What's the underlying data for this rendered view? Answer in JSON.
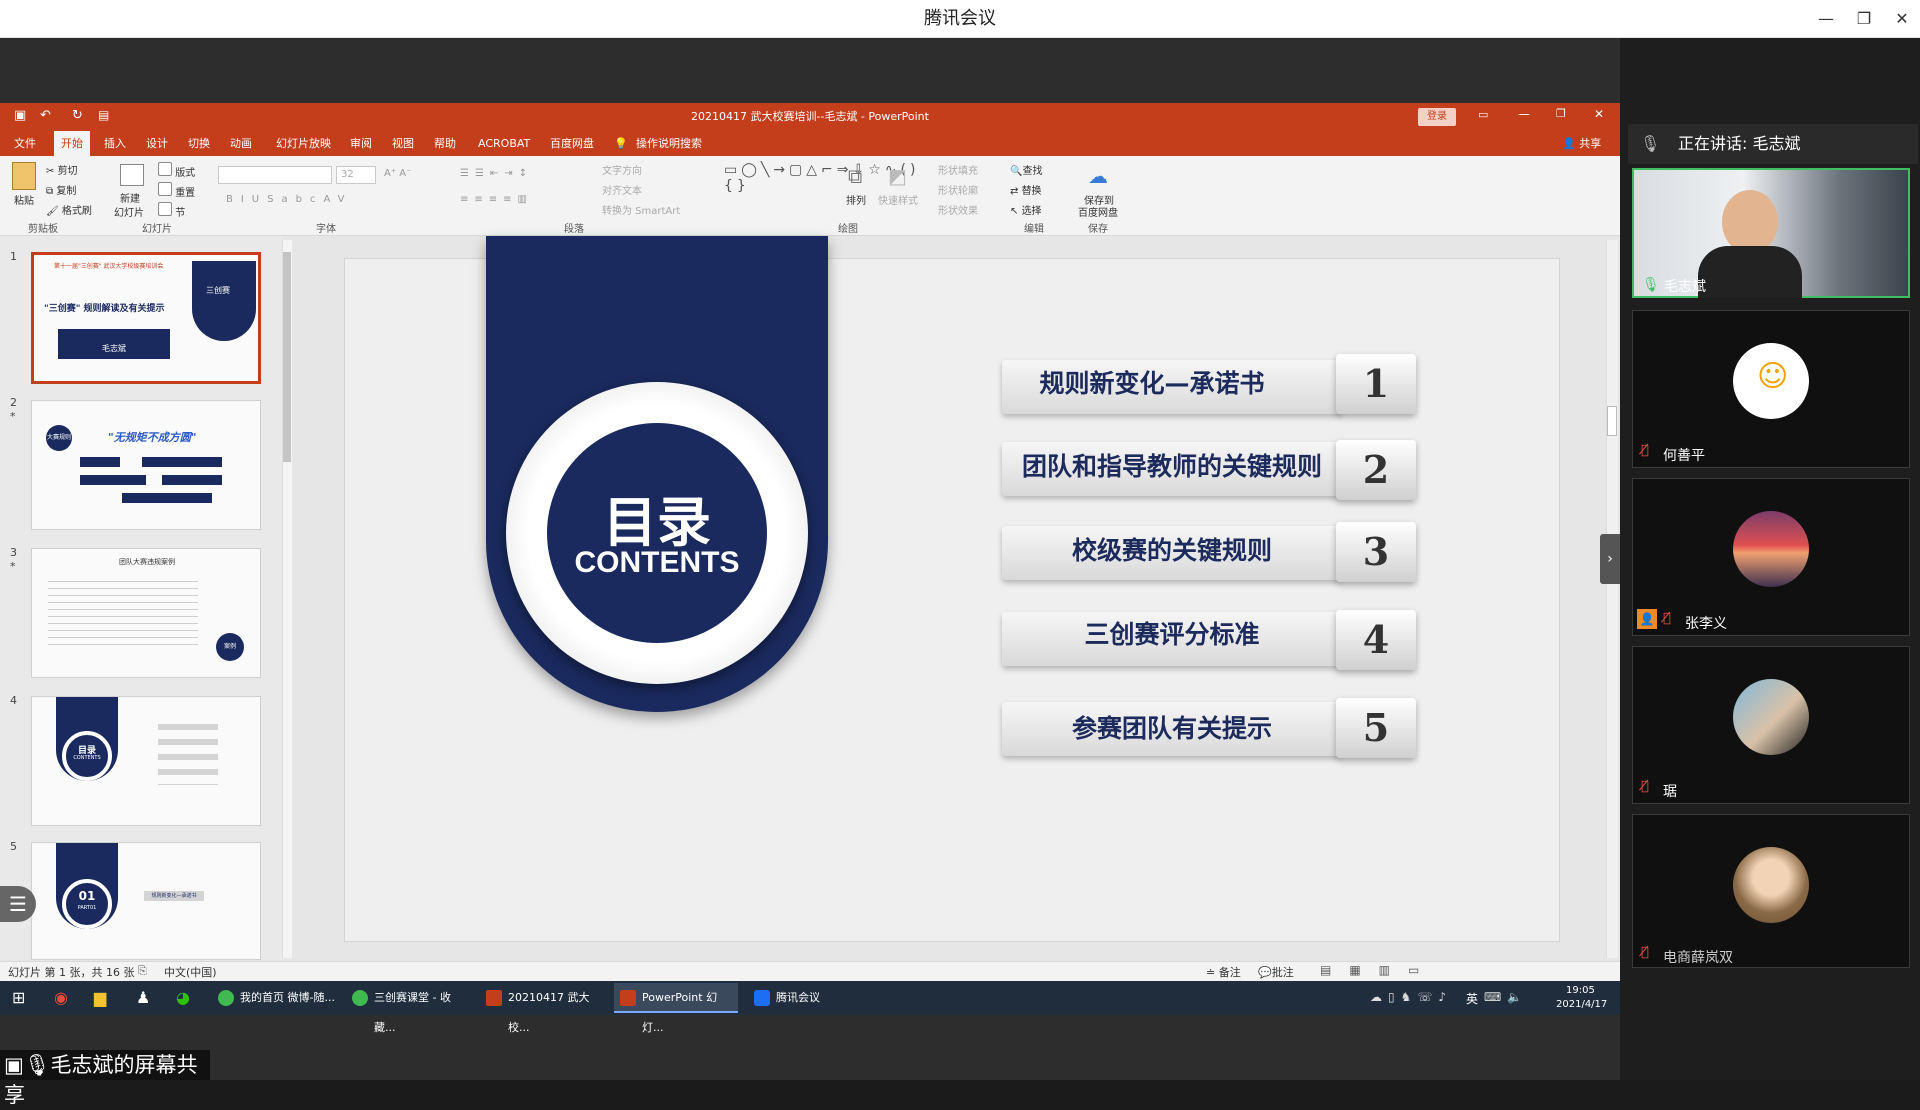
{
  "meeting": {
    "title": "腾讯会议",
    "speaking": "正在讲话: 毛志斌",
    "share_caption": "毛志斌的屏幕共享",
    "participants": [
      {
        "name": "毛志斌"
      },
      {
        "name": "何善平"
      },
      {
        "name": "张李义"
      },
      {
        "name": "琚"
      },
      {
        "name": "电商薛岚双"
      }
    ]
  },
  "ppt": {
    "window_title": "20210417 武大校赛培训--毛志斌  -  PowerPoint",
    "login": "登录",
    "share": "共享",
    "tabs": [
      "文件",
      "开始",
      "插入",
      "设计",
      "切换",
      "动画",
      "幻灯片放映",
      "审阅",
      "视图",
      "帮助",
      "ACROBAT",
      "百度网盘"
    ],
    "tell_me": "操作说明搜索",
    "ribbon": {
      "clipboard": {
        "paste": "粘贴",
        "cut": "剪切",
        "copy": "复制",
        "format": "格式刷",
        "group": "剪贴板"
      },
      "slides": {
        "new": "新建",
        "new2": "幻灯片",
        "layout": "版式",
        "reset": "重置",
        "section": "节",
        "group": "幻灯片"
      },
      "font_group": "字体",
      "font_size": "32",
      "paragraph_group": "段落",
      "text_direction": "文字方向",
      "align_text": "对齐文本",
      "smartart": "转换为 SmartArt",
      "arrange": "排列",
      "quick_styles": "快速样式",
      "fill": "形状填充",
      "outline": "形状轮廓",
      "effect": "形状效果",
      "drawing_group": "绘图",
      "find": "查找",
      "replace": "替换",
      "select": "选择",
      "edit_group": "编辑",
      "save_baidu": "保存到",
      "save_baidu2": "百度网盘",
      "save_group": "保存"
    },
    "status": {
      "slide_info": "幻灯片 第 1 张，共 16 张",
      "language": "中文(中国)",
      "notes": "备注",
      "comments": "批注"
    },
    "thumbnails": [
      {
        "num": "1",
        "title": "\"三创赛\" 规则解读及有关提示",
        "banner": "第十一届\"三创赛\" 武汉大学校级赛培训会",
        "seal": "三创赛",
        "name": "毛志斌"
      },
      {
        "num": "2",
        "title": "\"无规矩不成方圆\"",
        "badge": "大赛规则"
      },
      {
        "num": "3",
        "title": "团队大赛违规案例",
        "badge": "案例"
      },
      {
        "num": "4",
        "title": "目录",
        "sub": "CONTENTS"
      },
      {
        "num": "5",
        "title": "01",
        "sub": "PART01",
        "item": "规则新变化—承诺书"
      }
    ]
  },
  "slide": {
    "heading": "目录",
    "subheading": "CONTENTS",
    "items": [
      {
        "label": "规则新变化—承诺书",
        "num": "1"
      },
      {
        "label": "团队和指导教师的关键规则",
        "num": "2"
      },
      {
        "label": "校级赛的关键规则",
        "num": "3"
      },
      {
        "label": "三创赛评分标准",
        "num": "4"
      },
      {
        "label": "参赛团队有关提示",
        "num": "5"
      }
    ]
  },
  "taskbar": {
    "items": [
      "我的首页 微博-随...",
      "三创赛课堂 - 收藏...",
      "20210417 武大校...",
      "PowerPoint 幻灯...",
      "腾讯会议"
    ],
    "ime": "英",
    "time": "19:05",
    "date": "2021/4/17"
  },
  "colors": {
    "ppt_accent": "#c43e1c",
    "navy": "#1a2a5e",
    "taskbar": "#1f2d3d"
  }
}
